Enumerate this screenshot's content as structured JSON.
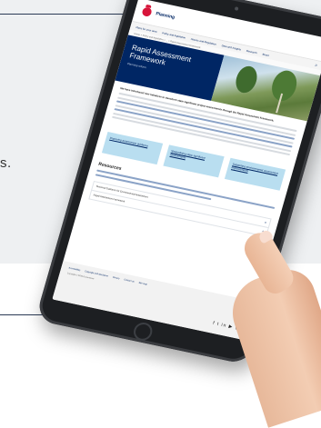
{
  "background": {
    "side_text": "s."
  },
  "site": {
    "brand": "Planning",
    "nav": [
      "Plans for your area",
      "Policy and legislation",
      "Assess and Regulation",
      "Data and Insights",
      "Research",
      "About"
    ],
    "breadcrumb": "Home > Policy and legislation > ... > Rapid Assessment Framework",
    "hero": {
      "title": "Rapid Assessment Framework",
      "subtitle": "Planning reform"
    },
    "intro": "We have introduced new initiatives to transform state significant project assessments through the Rapid Assessment Framework.",
    "cards": [
      "Improving assessment guidance",
      "Streamlining state significant assessments",
      "Supporting environmental assessment improvements"
    ],
    "resources_title": "Resources",
    "accordion": [
      "Technical Guidance for Environmental Assessment",
      "Rapid Assessment Framework"
    ],
    "footer_links": [
      "Accessibility",
      "Copyright and disclaimer",
      "Privacy",
      "Contact us",
      "Site map"
    ],
    "footer_copy": "Copyright © NSW Government",
    "social": "f t in ▶ ◎"
  }
}
